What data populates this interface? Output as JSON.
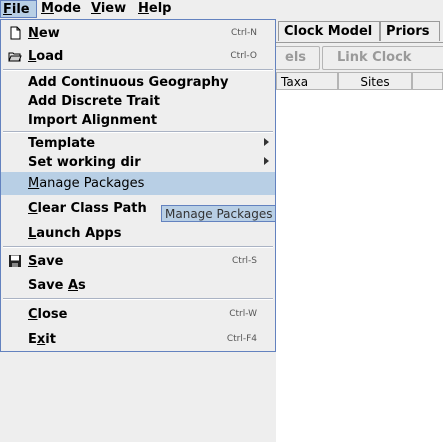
{
  "menubar": {
    "items": [
      {
        "mn": "F",
        "rest": "ile"
      },
      {
        "mn": "M",
        "rest": "ode"
      },
      {
        "mn": "V",
        "rest": "iew"
      },
      {
        "mn": "H",
        "rest": "elp"
      }
    ]
  },
  "tabs": [
    "Clock Model",
    "Priors"
  ],
  "toolbar": {
    "partial_button": "els",
    "link_button": "Link Clock Mode"
  },
  "table": {
    "headers": [
      "Taxa",
      "Sites"
    ]
  },
  "file_menu": {
    "new": {
      "mn": "N",
      "rest": "ew",
      "shortcut": "Ctrl-N",
      "icon": "new-file-icon"
    },
    "load": {
      "mn": "L",
      "rest": "oad",
      "shortcut": "Ctrl-O",
      "icon": "open-folder-icon"
    },
    "add_continuous": "Add Continuous Geography",
    "add_discrete": "Add Discrete Trait",
    "import_alignment": "Import Alignment",
    "template": "Template",
    "set_working_dir": "Set working dir",
    "manage_packages": {
      "pre": "",
      "mn": "M",
      "rest": "anage Packages"
    },
    "clear_class_path": {
      "mn": "C",
      "rest": "lear Class Path"
    },
    "launch_apps": {
      "mn": "L",
      "rest": "aunch Apps"
    },
    "save": {
      "mn": "S",
      "rest": "ave",
      "shortcut": "Ctrl-S",
      "icon": "save-disk-icon"
    },
    "save_as": {
      "pre": "Save ",
      "mn": "A",
      "rest": "s"
    },
    "close": {
      "mn": "C",
      "rest": "lose",
      "shortcut": "Ctrl-W"
    },
    "exit": {
      "pre": "E",
      "mn": "x",
      "rest": "it",
      "shortcut": "Ctrl-F4"
    }
  },
  "tooltip": "Manage Packages",
  "colors": {
    "highlight": "#b8cfe5",
    "border": "#6382bf",
    "background": "#eeeeee"
  }
}
